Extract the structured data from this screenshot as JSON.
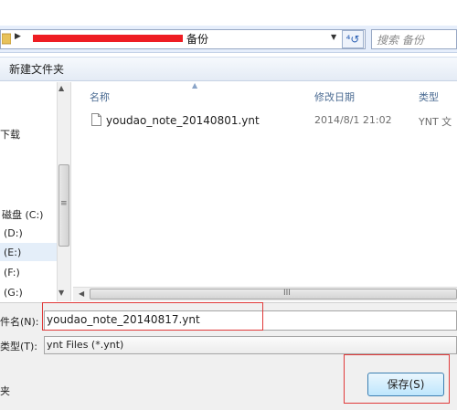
{
  "address_bar": {
    "folder": "备份",
    "dropdown_icon": "chevron-down-icon",
    "refresh_icon": "refresh-icon",
    "refresh_glyph": "⁴↺"
  },
  "search": {
    "placeholder": "搜索 备份"
  },
  "toolbar": {
    "new_folder_label": "新建文件夹"
  },
  "nav": {
    "items": [
      {
        "label": "下载"
      },
      {
        "label": "磁盘 (C:)"
      },
      {
        "label": "(D:)"
      },
      {
        "label": "(E:)"
      },
      {
        "label": "(F:)"
      },
      {
        "label": "(G:)"
      }
    ],
    "selected_index": 3
  },
  "file_list": {
    "columns": {
      "name": "名称",
      "date": "修改日期",
      "type": "类型"
    },
    "rows": [
      {
        "name": "youdao_note_20140801.ynt",
        "date": "2014/8/1 21:02",
        "type": "YNT 文"
      }
    ]
  },
  "hscroll": {
    "grip": "III"
  },
  "form": {
    "filename_label": "件名(N):",
    "filename_value": "youdao_note_20140817.ynt",
    "filetype_label": "类型(T):",
    "filetype_value": "ynt Files (*.ynt)",
    "folder_label": "夹"
  },
  "buttons": {
    "save_label": "保存(S)"
  },
  "colors": {
    "highlight_red": "#e03a3a",
    "redaction_red": "#ee1d23",
    "accent_blue": "#3c7fb1"
  }
}
